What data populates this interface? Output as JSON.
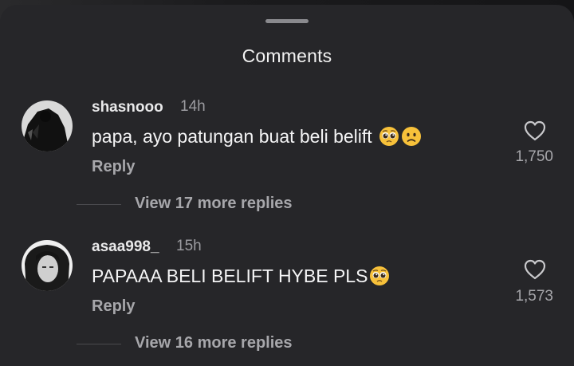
{
  "sheet": {
    "title": "Comments"
  },
  "comments": [
    {
      "username": "shasnooo",
      "time": "14h",
      "text": "papa, ayo patungan buat beli belift",
      "emojis": [
        "pleading-face",
        "frowning-face"
      ],
      "reply_label": "Reply",
      "likes": "1,750",
      "view_replies": "View 17 more replies"
    },
    {
      "username": "asaa998_",
      "time": "15h",
      "text": "PAPAAA BELI BELIFT HYBE PLS",
      "emojis": [
        "pleading-face"
      ],
      "reply_label": "Reply",
      "likes": "1,573",
      "view_replies": "View 16 more replies"
    }
  ],
  "colors": {
    "sheet_bg": "#262629",
    "text_primary": "#f4f4f5",
    "text_secondary": "#a7a7ab",
    "emoji_yellow": "#f7c13a"
  }
}
